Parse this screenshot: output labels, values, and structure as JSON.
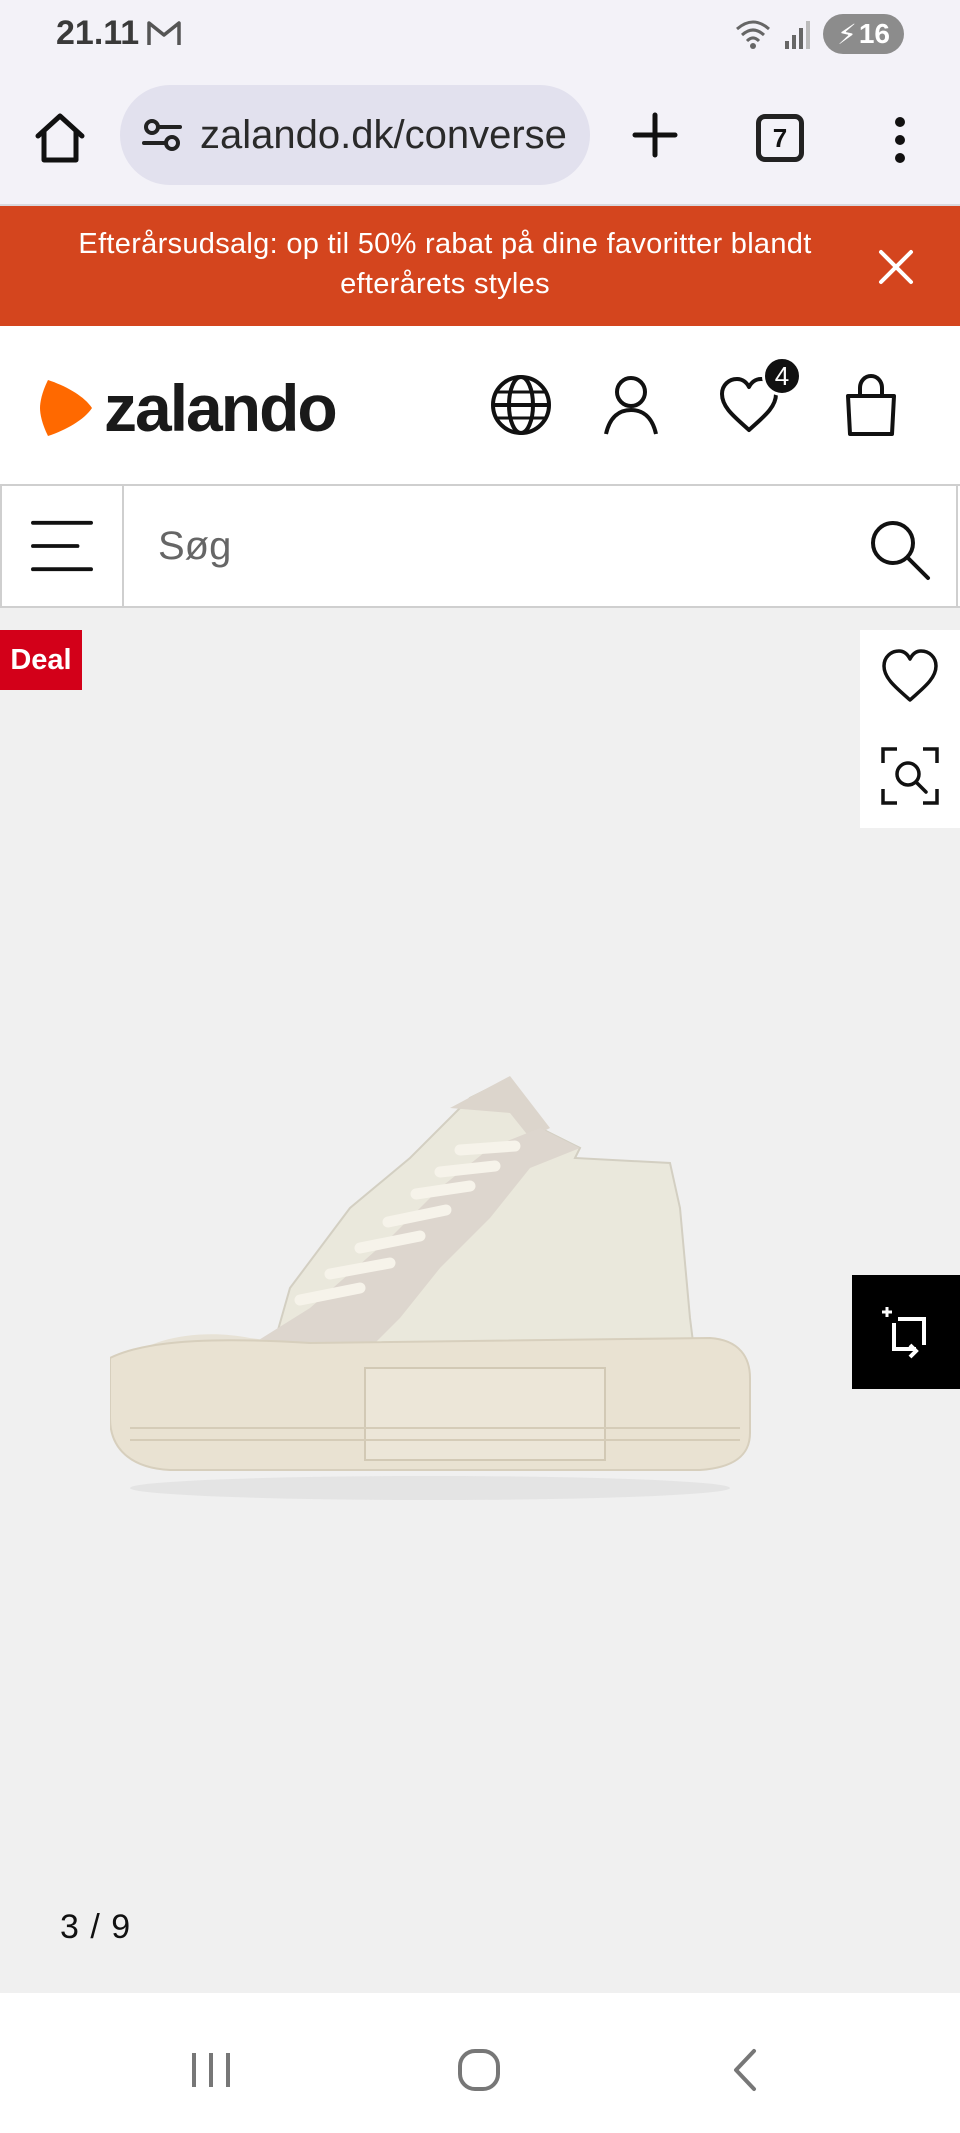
{
  "status_bar": {
    "time": "21.11",
    "battery_level": "16",
    "icons": [
      "gmail-icon",
      "wifi-icon",
      "signal-icon",
      "battery-charging-icon"
    ]
  },
  "browser": {
    "url": "zalando.dk/converse",
    "tab_count": "7",
    "icons": [
      "home-icon",
      "site-settings-icon",
      "plus-icon",
      "tabs-icon",
      "more-vert-icon"
    ]
  },
  "promo": {
    "text": "Efterårsudsalg: op til 50% rabat på dine favoritter blandt efterårets styles",
    "background": "#d4451e",
    "close_icon": "close-icon"
  },
  "header": {
    "logo_text": "zalando",
    "brand_color": "#ff6900",
    "wishlist_count": "4",
    "icons": [
      "globe-icon",
      "account-icon",
      "heart-icon",
      "shopping-bag-icon"
    ]
  },
  "search": {
    "placeholder": "Søg",
    "icons": [
      "hamburger-menu-icon",
      "search-icon"
    ]
  },
  "gallery": {
    "deal_label": "Deal",
    "deal_color": "#d30019",
    "page_counter": "3 / 9",
    "icons": [
      "heart-outline-icon",
      "visual-search-icon",
      "compare-icon"
    ],
    "image": "high-top-sneaker-off-white"
  },
  "nav_bar": {
    "icons": [
      "recents-icon",
      "home-circle-icon",
      "back-icon"
    ]
  }
}
